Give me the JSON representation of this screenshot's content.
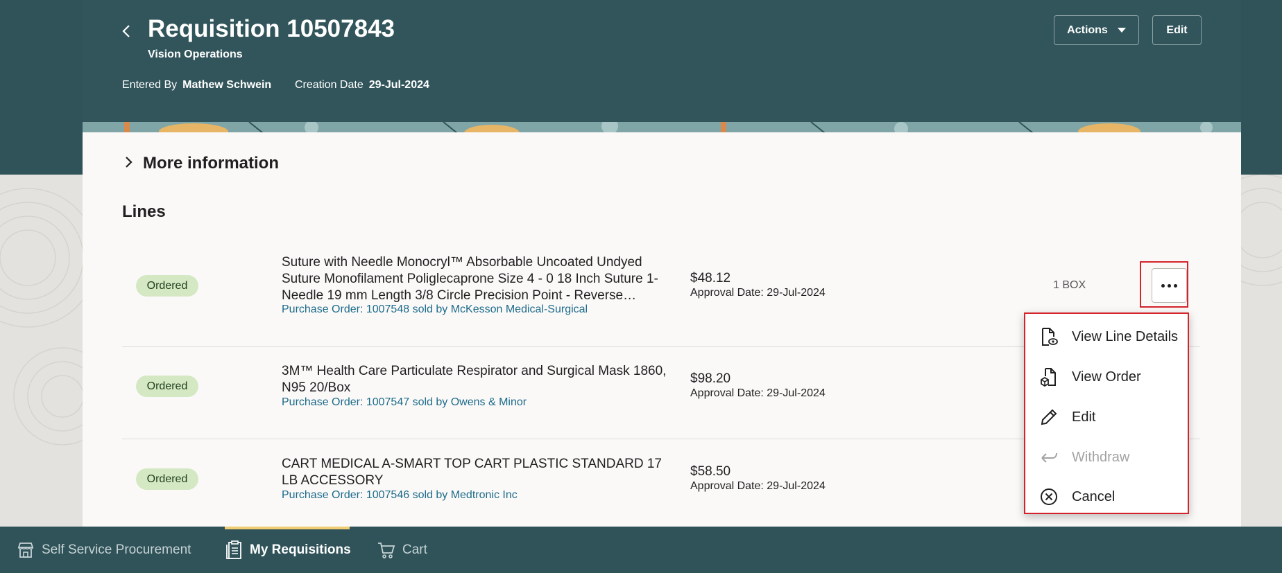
{
  "header": {
    "title": "Requisition 10507843",
    "subtitle": "Vision Operations",
    "entered_by_label": "Entered By",
    "entered_by_value": "Mathew Schwein",
    "creation_date_label": "Creation Date",
    "creation_date_value": "29-Jul-2024",
    "actions_label": "Actions",
    "edit_label": "Edit"
  },
  "more_info_label": "More information",
  "lines_title": "Lines",
  "lines": [
    {
      "status": "Ordered",
      "description": "Suture with Needle Monocryl™ Absorbable Uncoated Undyed Suture Monofilament Poliglecaprone Size 4 - 0 18 Inch Suture 1-Needle 19 mm Length 3/8 Circle Precision Point - Reverse…",
      "po": "Purchase Order: 1007548 sold by McKesson Medical-Surgical",
      "price": "$48.12",
      "approval": "Approval Date: 29-Jul-2024",
      "qty": "1 BOX"
    },
    {
      "status": "Ordered",
      "description": "3M™ Health Care Particulate Respirator and Surgical Mask 1860, N95 20/Box",
      "po": "Purchase Order: 1007547 sold by Owens & Minor",
      "price": "$98.20",
      "approval": "Approval Date: 29-Jul-2024"
    },
    {
      "status": "Ordered",
      "description": "CART MEDICAL A-SMART TOP CART PLASTIC STANDARD 17 LB ACCESSORY",
      "po": "Purchase Order: 1007546 sold by Medtronic Inc",
      "price": "$58.50",
      "approval": "Approval Date: 29-Jul-2024"
    }
  ],
  "menu": {
    "items": [
      {
        "label": "View Line Details",
        "icon": "document-view-icon",
        "enabled": true
      },
      {
        "label": "View Order",
        "icon": "document-order-icon",
        "enabled": true
      },
      {
        "label": "Edit",
        "icon": "pencil-icon",
        "enabled": true
      },
      {
        "label": "Withdraw",
        "icon": "undo-icon",
        "enabled": false
      },
      {
        "label": "Cancel",
        "icon": "cancel-circle-icon",
        "enabled": true
      }
    ]
  },
  "nav": {
    "items": [
      {
        "label": "Self Service Procurement",
        "icon": "store-icon"
      },
      {
        "label": "My Requisitions",
        "icon": "clipboard-icon",
        "active": true
      },
      {
        "label": "Cart",
        "icon": "cart-icon"
      }
    ]
  },
  "colors": {
    "header_bg": "#2f5359",
    "badge_bg": "#d4e8c4",
    "link": "#1b6b8a",
    "highlight_red": "#d4232a",
    "nav_active_bar": "#f0cc72"
  }
}
